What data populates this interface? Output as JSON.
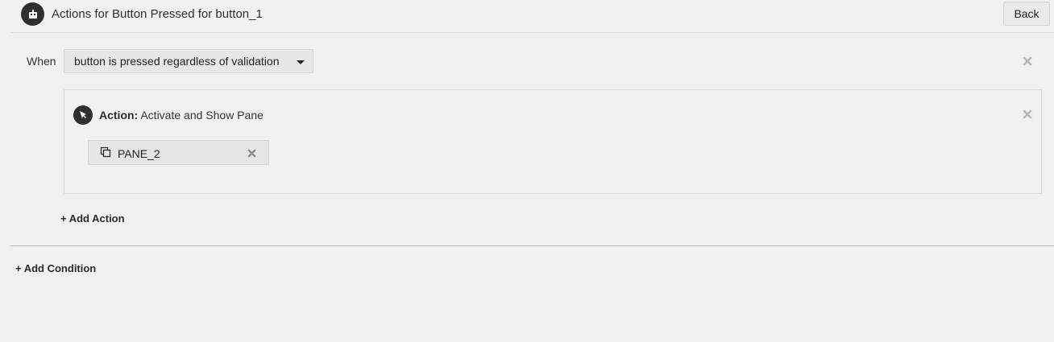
{
  "header": {
    "title": "Actions for Button Pressed for button_1",
    "back_label": "Back",
    "icon": "button-icon"
  },
  "condition": {
    "when_label": "When",
    "when_value": "button is pressed regardless of validation",
    "remove_icon": "close-icon"
  },
  "action": {
    "prefix": "Action:",
    "name": "Activate and Show Pane",
    "icon": "cursor-pointer-icon",
    "remove_icon": "close-icon",
    "targets": [
      {
        "label": "PANE_2",
        "icon": "pane-copy-icon",
        "remove_icon": "close-icon"
      }
    ]
  },
  "add_action_label": "+ Add Action",
  "add_condition_label": "+ Add Condition",
  "colors": {
    "background": "#f0f1f3",
    "icon_dark": "#2e2f31",
    "close_gray": "#b4b6b9"
  }
}
